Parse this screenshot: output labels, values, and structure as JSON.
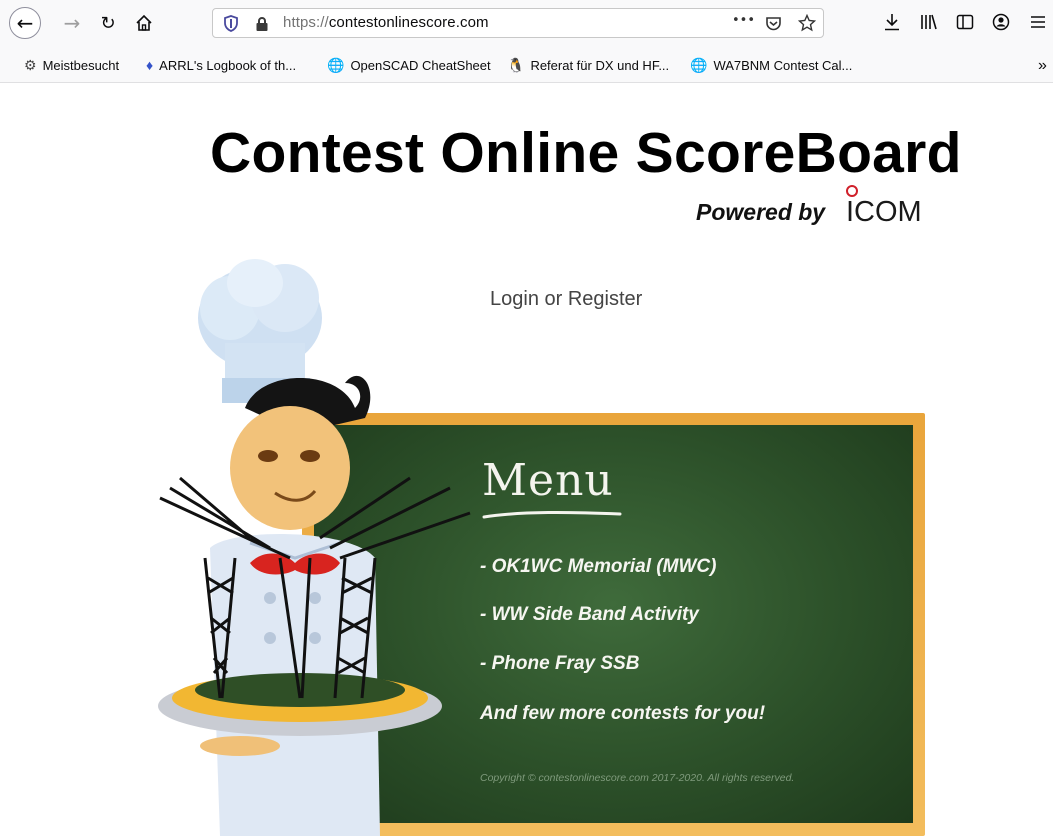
{
  "browser": {
    "url_scheme": "https://",
    "url_host": "contestonlinescore.com",
    "page_actions": "•••"
  },
  "bookmarks": [
    {
      "label": "Meistbesucht",
      "icon": "gear-icon"
    },
    {
      "label": "ARRL's Logbook of th...",
      "icon": "arrl-diamond-icon"
    },
    {
      "label": "OpenSCAD CheatSheet",
      "icon": "globe-icon"
    },
    {
      "label": "Referat für DX und HF...",
      "icon": "tux-icon"
    },
    {
      "label": "WA7BNM Contest Cal...",
      "icon": "globe-icon"
    }
  ],
  "page": {
    "title": "Contest Online ScoreBoard",
    "powered_by": "Powered by",
    "logo_text": "ICOM",
    "login_link": "Login or Register"
  },
  "menu": {
    "title": "Menu",
    "items": [
      "- OK1WC Memorial (MWC)",
      "- WW Side Band Activity",
      "- Phone Fray SSB",
      "And few more contests for you!"
    ],
    "copyright": "Copyright © contestonlinescore.com 2017-2020. All rights reserved."
  },
  "colors": {
    "board_green": "#2c5029",
    "frame_orange": "#f0b34e",
    "icom_red": "#d0202a"
  }
}
